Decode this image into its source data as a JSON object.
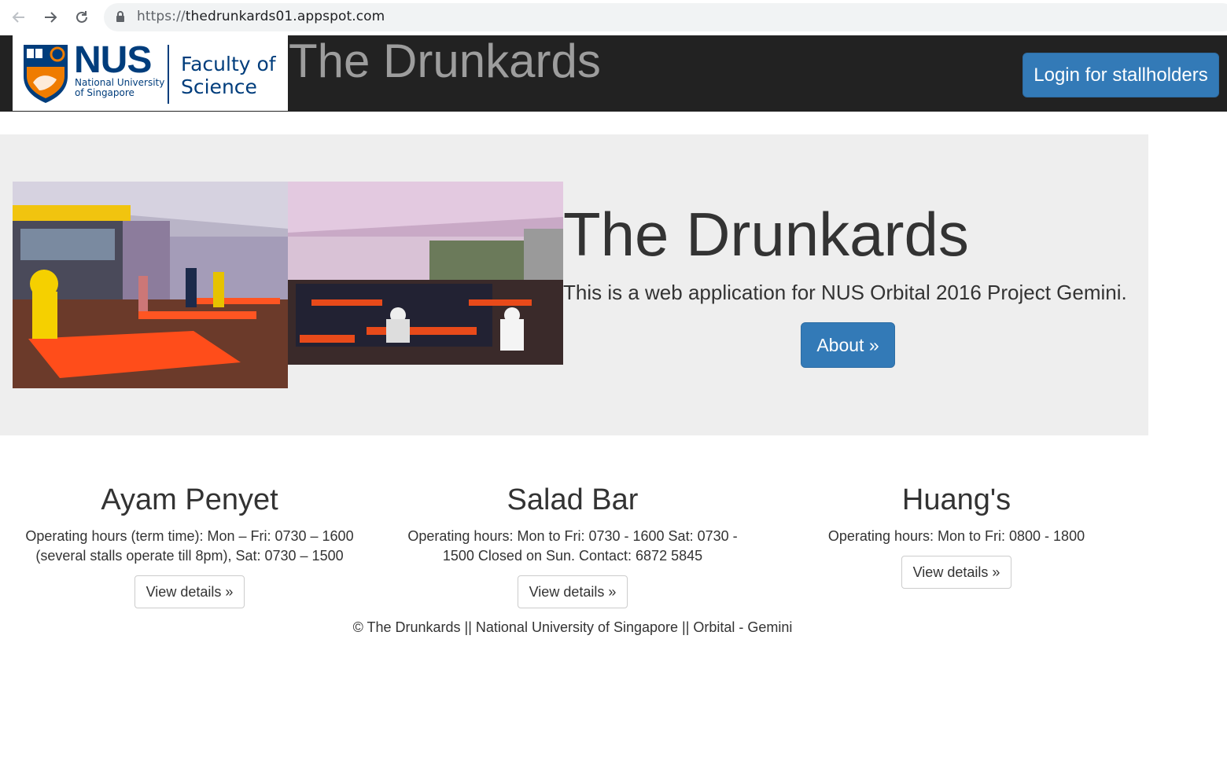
{
  "browser": {
    "url_scheme": "https://",
    "url_host": "thedrunkards01.appspot.com"
  },
  "navbar": {
    "logo": {
      "acronym": "NUS",
      "university": "National University of Singapore",
      "faculty": "Faculty of Science"
    },
    "brand": "The Drunkards",
    "login_label": "Login for stallholders"
  },
  "jumbotron": {
    "title": "The Drunkards",
    "lead": "This is a web application for NUS Orbital 2016 Project Gemini.",
    "about_label": "About »"
  },
  "stalls": [
    {
      "name": "Ayam Penyet",
      "hours": "Operating hours (term time): Mon – Fri: 0730 – 1600 (several stalls operate till 8pm), Sat: 0730 – 1500",
      "button": "View details »"
    },
    {
      "name": "Salad Bar",
      "hours": "Operating hours: Mon to Fri: 0730 - 1600 Sat: 0730 - 1500 Closed on Sun. Contact: 6872 5845",
      "button": "View details »"
    },
    {
      "name": "Huang's",
      "hours": "Operating hours: Mon to Fri: 0800 - 1800",
      "button": "View details »"
    }
  ],
  "footer": "© The Drunkards || National University of Singapore || Orbital - Gemini",
  "colors": {
    "navbar_bg": "#222222",
    "primary": "#337ab7",
    "jumbotron_bg": "#eeeeee",
    "nus_blue": "#003d7c",
    "nus_orange": "#ef7c00"
  }
}
